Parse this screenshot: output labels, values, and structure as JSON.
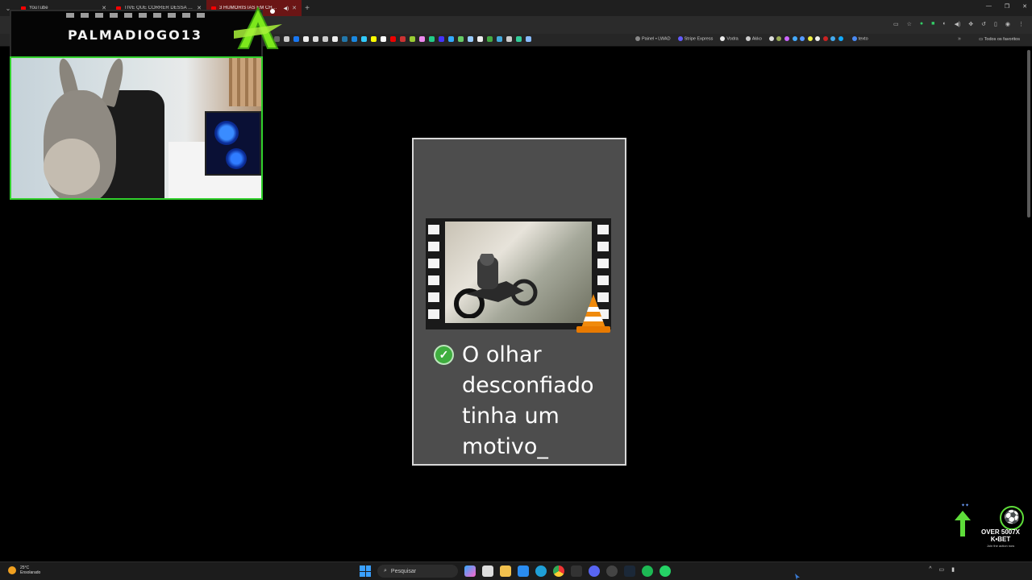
{
  "browser": {
    "tabs": [
      {
        "label": "YouTube",
        "active": false
      },
      {
        "label": "TIVE QUE CORRER DESSA SITU...",
        "active": false
      },
      {
        "label": "3 HUMORISTAS EM CHOQ...",
        "active": true
      }
    ],
    "bookmarks": {
      "named": [
        "Painel • LWAD",
        "Stripe Express",
        "Vodra",
        "Akko",
        "texto"
      ],
      "all_favorites": "Todos os favoritos"
    }
  },
  "overlay": {
    "streamer_name": "PALMADIOGO13"
  },
  "file_item": {
    "name": "O olhar desconfiado tinha um motivo_",
    "status": "synced",
    "thumbnail": "video-file-with-vlc-cone"
  },
  "promo": {
    "title": "OVER 5007X K•BET",
    "subtitle": "Join the action now"
  },
  "taskbar": {
    "weather_temp": "25°C",
    "weather_desc": "Ensolarado",
    "search_placeholder": "Pesquisar"
  },
  "colors": {
    "overlay_green": "#31d02c",
    "active_tab": "#6b1515",
    "card_bg": "#4d4d4d",
    "check_green": "#3fae3f"
  }
}
